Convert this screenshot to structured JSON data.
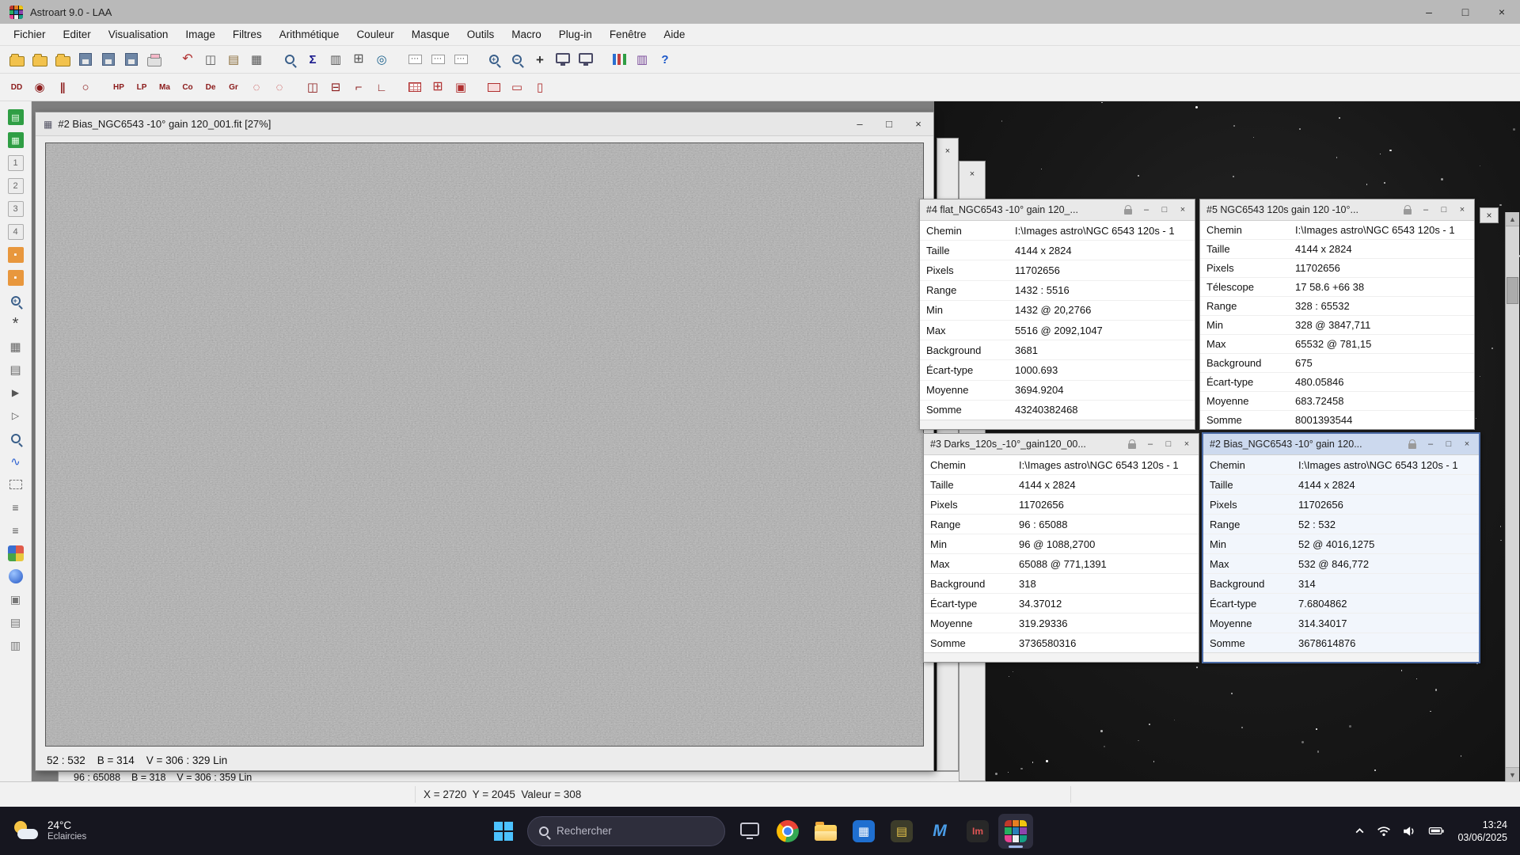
{
  "app": {
    "title": "Astroart 9.0 - LAA",
    "menus": [
      "Fichier",
      "Editer",
      "Visualisation",
      "Image",
      "Filtres",
      "Arithmétique",
      "Couleur",
      "Masque",
      "Outils",
      "Macro",
      "Plug-in",
      "Fenêtre",
      "Aide"
    ]
  },
  "window_controls": {
    "minimize": "–",
    "maximize": "□",
    "close": "×"
  },
  "scrollbar": {
    "up": "▲",
    "down": "▼"
  },
  "icons": {
    "image_window": "▦"
  },
  "astroart_palette": [
    "#c0392b",
    "#e67e22",
    "#f1c40f",
    "#27ae60",
    "#2980b9",
    "#8e44ad",
    "#e84393",
    "#ecf0f1",
    "#16a085"
  ],
  "toolbar_main": [
    {
      "n": "new-image-icon",
      "k": "folder"
    },
    {
      "n": "open-file-icon",
      "k": "folder"
    },
    {
      "n": "open-recent-icon",
      "k": "folder"
    },
    {
      "n": "save-icon",
      "k": "floppy"
    },
    {
      "n": "save-as-icon",
      "k": "floppy"
    },
    {
      "n": "export-icon",
      "k": "floppy"
    },
    {
      "n": "print-icon",
      "k": "printer"
    },
    {
      "sep": true
    },
    {
      "n": "undo-icon",
      "k": "glyph",
      "g": "↶",
      "c": "#b03030",
      "s": 16
    },
    {
      "n": "copy-icon",
      "k": "glyph",
      "g": "◫",
      "c": "#555",
      "s": 15
    },
    {
      "n": "paste-icon",
      "k": "glyph",
      "g": "▤",
      "c": "#8a6d3b",
      "s": 15
    },
    {
      "n": "duplicate-icon",
      "k": "glyph",
      "g": "▦",
      "c": "#555",
      "s": 15
    },
    {
      "sep": true
    },
    {
      "n": "magnifier-icon",
      "k": "mag"
    },
    {
      "n": "statistics-icon",
      "k": "glyph",
      "g": "Σ",
      "c": "#19198c",
      "s": 15,
      "b": 1
    },
    {
      "n": "histogram-icon",
      "k": "glyph",
      "g": "▥",
      "c": "#555",
      "s": 15
    },
    {
      "n": "grid-view-icon",
      "k": "glyph",
      "g": "⊞",
      "c": "#555",
      "s": 16
    },
    {
      "n": "preview-icon",
      "k": "glyph",
      "g": "◎",
      "c": "#19608c",
      "s": 15
    },
    {
      "sep": true
    },
    {
      "n": "select-mode-icon",
      "k": "dots",
      "g": "⋯"
    },
    {
      "n": "select-mode-2-icon",
      "k": "dots",
      "g": "⋯"
    },
    {
      "n": "select-mode-3-icon",
      "k": "dots",
      "g": "⋯"
    },
    {
      "sep": true
    },
    {
      "n": "zoom-in-icon",
      "k": "mag",
      "v": "+"
    },
    {
      "n": "zoom-out-icon",
      "k": "mag",
      "v": "−"
    },
    {
      "n": "zoom-reset-icon",
      "k": "glyph",
      "g": "+",
      "c": "#333",
      "s": 17,
      "b": 1
    },
    {
      "n": "fit-screen-icon",
      "k": "monitor"
    },
    {
      "n": "full-screen-icon",
      "k": "monitor"
    },
    {
      "sep": true
    },
    {
      "n": "chart-icon",
      "k": "bars"
    },
    {
      "n": "columns-icon",
      "k": "glyph",
      "g": "▥",
      "c": "#7a4a9a",
      "s": 15
    },
    {
      "n": "help-icon",
      "k": "glyph",
      "g": "?",
      "c": "#1a56c8",
      "s": 15,
      "b": 1
    }
  ],
  "toolbar_process": [
    {
      "n": "dd-calibration-icon",
      "k": "text",
      "t": "DD"
    },
    {
      "n": "aperture-icon",
      "k": "glyph",
      "g": "◉",
      "c": "#8b1a1a",
      "s": 15
    },
    {
      "n": "pause-icon",
      "k": "glyph",
      "g": "∥",
      "c": "#8b1a1a",
      "s": 14,
      "b": 1
    },
    {
      "n": "circle-icon",
      "k": "glyph",
      "g": "○",
      "c": "#8b1a1a",
      "s": 15
    },
    {
      "sep": true
    },
    {
      "n": "hp-filter-icon",
      "k": "text",
      "t": "HP"
    },
    {
      "n": "lp-filter-icon",
      "k": "text",
      "t": "LP"
    },
    {
      "n": "ma-filter-icon",
      "k": "text",
      "t": "Ma"
    },
    {
      "n": "co-filter-icon",
      "k": "text",
      "t": "Co"
    },
    {
      "n": "de-filter-icon",
      "k": "text",
      "t": "De"
    },
    {
      "n": "gr-filter-icon",
      "k": "text",
      "t": "Gr"
    },
    {
      "n": "dotted-circle-icon",
      "k": "glyph",
      "g": "◌",
      "c": "#c03030",
      "s": 15
    },
    {
      "n": "dotted-circle-2-icon",
      "k": "glyph",
      "g": "◌",
      "c": "#c03030",
      "s": 15
    },
    {
      "sep": true
    },
    {
      "n": "split-vertical-icon",
      "k": "glyph",
      "g": "◫",
      "c": "#8b1a1a",
      "s": 15
    },
    {
      "n": "split-horizontal-icon",
      "k": "glyph",
      "g": "⊟",
      "c": "#8b1a1a",
      "s": 15
    },
    {
      "n": "crop-corner-icon",
      "k": "glyph",
      "g": "⌐",
      "c": "#8b1a1a",
      "s": 15
    },
    {
      "n": "angle-icon",
      "k": "glyph",
      "g": "∟",
      "c": "#8b1a1a",
      "s": 14
    },
    {
      "sep": true
    },
    {
      "n": "grid-red-icon",
      "k": "rgrid"
    },
    {
      "n": "tile-windows-icon",
      "k": "glyph",
      "g": "⊞",
      "c": "#b03030",
      "s": 16
    },
    {
      "n": "cascade-windows-icon",
      "k": "glyph",
      "g": "▣",
      "c": "#b03030",
      "s": 15
    },
    {
      "sep": true
    },
    {
      "n": "rect-select-icon",
      "k": "rbox"
    },
    {
      "n": "red-folder-icon",
      "k": "glyph",
      "g": "▭",
      "c": "#b03030",
      "s": 15
    },
    {
      "n": "red-panel-icon",
      "k": "glyph",
      "g": "▯",
      "c": "#b03030",
      "s": 15
    }
  ],
  "sidebar_tools": [
    {
      "n": "buffer-green-1-icon",
      "k": "tile",
      "bg": "#2f9e44",
      "g": "▤",
      "c": "#eaffea"
    },
    {
      "n": "buffer-green-2-icon",
      "k": "tile",
      "bg": "#2f9e44",
      "g": "▦",
      "c": "#eaffea"
    },
    {
      "n": "buffer-1-icon",
      "k": "tile",
      "bg": "#ececec",
      "g": "1",
      "c": "#666",
      "bd": 1
    },
    {
      "n": "buffer-2-icon",
      "k": "tile",
      "bg": "#ececec",
      "g": "2",
      "c": "#666",
      "bd": 1
    },
    {
      "n": "buffer-3-icon",
      "k": "tile",
      "bg": "#ececec",
      "g": "3",
      "c": "#666",
      "bd": 1
    },
    {
      "n": "buffer-4-icon",
      "k": "tile",
      "bg": "#ececec",
      "g": "4",
      "c": "#666",
      "bd": 1
    },
    {
      "n": "buffer-orange-1-icon",
      "k": "tile",
      "bg": "#e8973d",
      "g": "▪",
      "c": "#fff"
    },
    {
      "n": "buffer-orange-2-icon",
      "k": "tile",
      "bg": "#e8973d",
      "g": "▪",
      "c": "#fff"
    },
    {
      "n": "zoom-star-icon",
      "k": "mag",
      "v": "+"
    },
    {
      "n": "star-detect-icon",
      "k": "glyph",
      "g": "*",
      "c": "#444",
      "s": 20
    },
    {
      "n": "grid-points-icon",
      "k": "glyph",
      "g": "▦",
      "c": "#666",
      "s": 15
    },
    {
      "n": "grid-lines-icon",
      "k": "glyph",
      "g": "▤",
      "c": "#666",
      "s": 15
    },
    {
      "n": "star-move-icon",
      "k": "glyph",
      "g": "▶",
      "c": "#555",
      "s": 12
    },
    {
      "n": "star-align-icon",
      "k": "glyph",
      "g": "▷",
      "c": "#555",
      "s": 12
    },
    {
      "n": "loupe-icon",
      "k": "mag"
    },
    {
      "n": "curve-icon",
      "k": "glyph",
      "g": "∿",
      "c": "#2a5fd0",
      "s": 15
    },
    {
      "n": "selection-icon",
      "k": "dash"
    },
    {
      "n": "annotation-icon",
      "k": "glyph",
      "g": "≡",
      "c": "#555",
      "s": 14
    },
    {
      "n": "annotation-2-icon",
      "k": "glyph",
      "g": "≡",
      "c": "#555",
      "s": 14
    },
    {
      "n": "palette-icon",
      "k": "pal"
    },
    {
      "n": "sphere-icon",
      "k": "ball"
    },
    {
      "n": "tool-a-icon",
      "k": "glyph",
      "g": "▣",
      "c": "#777",
      "s": 14
    },
    {
      "n": "tool-b-icon",
      "k": "glyph",
      "g": "▤",
      "c": "#777",
      "s": 14
    },
    {
      "n": "tool-c-icon",
      "k": "glyph",
      "g": "▥",
      "c": "#777",
      "s": 14
    }
  ],
  "image_window": {
    "title": "#2 Bias_NGC6543 -10° gain 120_001.fit  [27%]",
    "status": "52 : 532    B = 314    V = 306 : 329 Lin"
  },
  "background_window": {
    "status": "96 : 65088    B = 318    V = 306 : 359 Lin"
  },
  "stat_panels": [
    {
      "title": "#4 flat_NGC6543 -10° gain 120_...",
      "active": false,
      "rows": [
        {
          "label": "Chemin",
          "value": "I:\\Images astro\\NGC 6543 120s - 1"
        },
        {
          "label": "Taille",
          "value": "4144 x 2824"
        },
        {
          "label": "Pixels",
          "value": "11702656"
        },
        {
          "label": "Range",
          "value": "1432 : 5516"
        },
        {
          "label": "Min",
          "value": "1432 @ 20,2766"
        },
        {
          "label": "Max",
          "value": "5516 @ 2092,1047"
        },
        {
          "label": "Background",
          "value": "3681"
        },
        {
          "label": "Écart-type",
          "value": "1000.693"
        },
        {
          "label": "Moyenne",
          "value": "3694.9204"
        },
        {
          "label": "Somme",
          "value": "43240382468"
        }
      ]
    },
    {
      "title": "#5 NGC6543 120s gain 120 -10°...",
      "active": false,
      "rows": [
        {
          "label": "Chemin",
          "value": "I:\\Images astro\\NGC 6543 120s - 1"
        },
        {
          "label": "Taille",
          "value": "4144 x 2824"
        },
        {
          "label": "Pixels",
          "value": "11702656"
        },
        {
          "label": "Télescope",
          "value": "17 58.6  +66 38"
        },
        {
          "label": "Range",
          "value": "328 : 65532"
        },
        {
          "label": "Min",
          "value": "328 @ 3847,711"
        },
        {
          "label": "Max",
          "value": "65532 @ 781,15"
        },
        {
          "label": "Background",
          "value": "675"
        },
        {
          "label": "Écart-type",
          "value": "480.05846"
        },
        {
          "label": "Moyenne",
          "value": "683.72458"
        },
        {
          "label": "Somme",
          "value": "8001393544"
        }
      ]
    },
    {
      "title": "#3 Darks_120s_-10°_gain120_00...",
      "active": false,
      "rows": [
        {
          "label": "Chemin",
          "value": "I:\\Images astro\\NGC 6543 120s - 1"
        },
        {
          "label": "Taille",
          "value": "4144 x 2824"
        },
        {
          "label": "Pixels",
          "value": "11702656"
        },
        {
          "label": "Range",
          "value": "96 : 65088"
        },
        {
          "label": "Min",
          "value": "96 @ 1088,2700"
        },
        {
          "label": "Max",
          "value": "65088 @ 771,1391"
        },
        {
          "label": "Background",
          "value": "318"
        },
        {
          "label": "Écart-type",
          "value": "34.37012"
        },
        {
          "label": "Moyenne",
          "value": "319.29336"
        },
        {
          "label": "Somme",
          "value": "3736580316"
        }
      ]
    },
    {
      "title": "#2 Bias_NGC6543 -10° gain 120...",
      "active": true,
      "rows": [
        {
          "label": "Chemin",
          "value": "I:\\Images astro\\NGC 6543 120s - 1"
        },
        {
          "label": "Taille",
          "value": "4144 x 2824"
        },
        {
          "label": "Pixels",
          "value": "11702656"
        },
        {
          "label": "Range",
          "value": "52 : 532"
        },
        {
          "label": "Min",
          "value": "52 @ 4016,1275"
        },
        {
          "label": "Max",
          "value": "532 @ 846,772"
        },
        {
          "label": "Background",
          "value": "314"
        },
        {
          "label": "Écart-type",
          "value": "7.6804862"
        },
        {
          "label": "Moyenne",
          "value": "314.34017"
        },
        {
          "label": "Somme",
          "value": "3678614876"
        }
      ]
    }
  ],
  "statusbar": {
    "text": "X = 2720  Y = 2045  Valeur = 308"
  },
  "taskbar": {
    "weather": {
      "temp": "24°C",
      "condition": "Eclaircies"
    },
    "search_placeholder": "Rechercher",
    "clock": {
      "time": "13:24",
      "date": "03/06/2025"
    }
  },
  "taskbar_apps": [
    {
      "n": "taskbar-desktop-icon",
      "k": "monitor2"
    },
    {
      "n": "taskbar-chrome-icon",
      "k": "chrome"
    },
    {
      "n": "taskbar-explorer-icon",
      "k": "xfolder"
    },
    {
      "n": "taskbar-app-blue-icon",
      "k": "tile2",
      "bg": "#1f6fd0",
      "g": "▦",
      "c": "#fff"
    },
    {
      "n": "taskbar-app-gold-icon",
      "k": "tile2",
      "bg": "#3c3c2a",
      "g": "▤",
      "c": "#e6c34a"
    },
    {
      "n": "taskbar-app-m-icon",
      "k": "mchar",
      "t": "M",
      "c": "#4a9de8",
      "s": 21,
      "b": 1
    },
    {
      "n": "taskbar-app-im-icon",
      "k": "tile2",
      "bg": "#282828",
      "g": "Im",
      "c": "#e05555",
      "fs": 12
    },
    {
      "n": "taskbar-astroart-icon",
      "k": "astro",
      "active": true
    }
  ]
}
